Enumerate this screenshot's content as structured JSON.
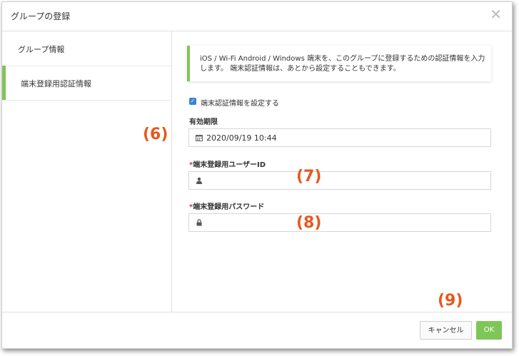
{
  "dialog": {
    "title": "グループの登録"
  },
  "sidebar": {
    "items": [
      {
        "label": "グループ情報"
      },
      {
        "label": "端末登録用認証情報"
      }
    ]
  },
  "info": {
    "text": "iOS / Wi-Fi Android / Windows 端末を、このグループに登録するための認証情報を入力します。 端末認証情報は、あとから設定することもできます。"
  },
  "form": {
    "set_credentials_label": "端末認証情報を設定する",
    "set_credentials_checked": true,
    "expiry": {
      "label": "有効期限",
      "value": "2020/09/19 10:44"
    },
    "user_id": {
      "required_mark": "*",
      "label": "端末登録用ユーザーID",
      "value": ""
    },
    "password": {
      "required_mark": "*",
      "label": "端末登録用パスワード",
      "value": ""
    }
  },
  "annotations": {
    "a6": "(6)",
    "a7": "(7)",
    "a8": "(8)",
    "a9": "(9)"
  },
  "footer": {
    "cancel_label": "キャンセル",
    "ok_label": "OK"
  },
  "colors": {
    "accent": "#7ec657",
    "required": "#e0302a",
    "annotation": "#e8581b",
    "checkbox": "#3b82d6"
  }
}
